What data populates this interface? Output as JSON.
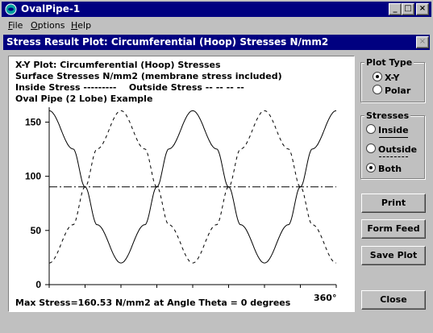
{
  "window": {
    "title": "OvalPipe-1",
    "controls": [
      "_",
      "□",
      "×"
    ]
  },
  "menu": [
    {
      "label": "File",
      "accel": "F",
      "rest": "ile"
    },
    {
      "label": "Options",
      "accel": "O",
      "rest": "ptions"
    },
    {
      "label": "Help",
      "accel": "H",
      "rest": "elp"
    }
  ],
  "child_window": {
    "title": "Stress Result Plot: Circumferential (Hoop) Stresses N/mm2",
    "close": "×"
  },
  "plot": {
    "heading1": "X-Y Plot: Circumferential (Hoop) Stresses",
    "heading2": "Surface Stresses N/mm2 (membrane stress included)",
    "legend_inside": "Inside Stress ---------",
    "legend_outside": "Outside Stress -- -- -- --",
    "heading4": "Oval Pipe (2 Lobe) Example",
    "footer": "Max Stress=160.53 N/mm2 at Angle Theta = 0   degrees",
    "x_end_label": "360°"
  },
  "chart_data": {
    "type": "line",
    "x": [
      0,
      30,
      45,
      60,
      90,
      120,
      135,
      150,
      180,
      210,
      225,
      240,
      270,
      300,
      315,
      330,
      360
    ],
    "ylim": [
      0,
      160
    ],
    "xlim": [
      0,
      360
    ],
    "yticks": [
      0,
      50,
      100,
      150
    ],
    "series": [
      {
        "name": "Inside Stress",
        "style": "solid",
        "values": [
          160.5,
          125.2,
          90.2,
          55.3,
          20.0,
          55.3,
          90.2,
          125.2,
          160.5,
          125.2,
          90.2,
          55.3,
          20.0,
          55.3,
          90.2,
          125.2,
          160.5
        ]
      },
      {
        "name": "Outside Stress",
        "style": "dashed",
        "values": [
          20.0,
          55.3,
          90.2,
          125.2,
          160.5,
          125.2,
          90.2,
          55.3,
          20.0,
          55.3,
          90.2,
          125.2,
          160.5,
          125.2,
          90.2,
          55.3,
          20.0
        ]
      },
      {
        "style": "dashdot",
        "values": [
          90.2,
          90.2,
          90.2,
          90.2,
          90.2,
          90.2,
          90.2,
          90.2,
          90.2,
          90.2,
          90.2,
          90.2,
          90.2,
          90.2,
          90.2,
          90.2,
          90.2
        ]
      }
    ]
  },
  "plot_type": {
    "label": "Plot Type",
    "options": [
      "X-Y",
      "Polar"
    ],
    "selected": "X-Y"
  },
  "stresses": {
    "label": "Stresses",
    "options": [
      "Inside",
      "Outside",
      "Both"
    ],
    "selected": "Both"
  },
  "buttons": {
    "print": "Print",
    "form_feed": "Form Feed",
    "save_plot": "Save Plot",
    "close": "Close"
  }
}
